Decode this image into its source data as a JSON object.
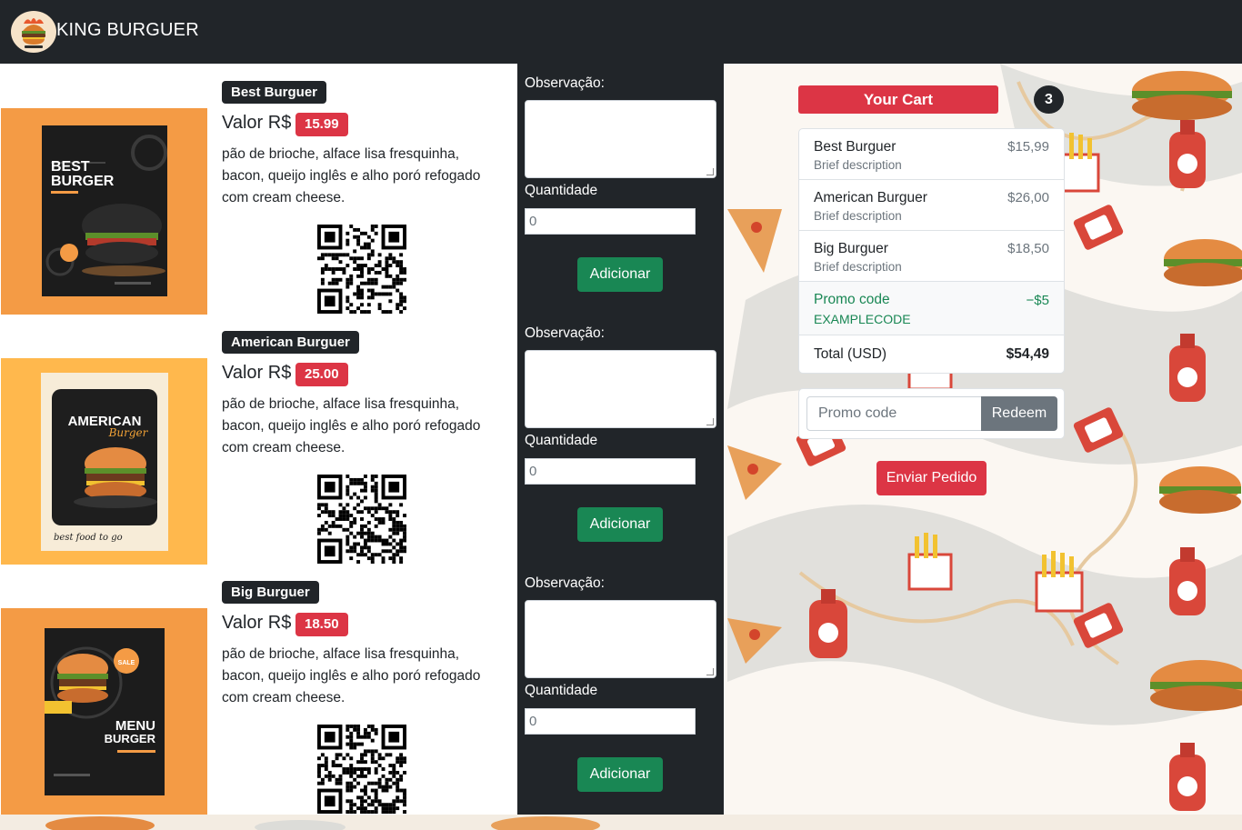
{
  "navbar": {
    "brand": "KING BURGUER",
    "logo_icon": "burger-logo-icon"
  },
  "products": [
    {
      "name": "Best Burguer",
      "valor_label": "Valor R$",
      "price": "15.99",
      "description": "pão de brioche, alface lisa fresquinha, bacon, queijo inglês e alho poró refogado com cream cheese.",
      "poster_text": [
        "BEST",
        "BURGER"
      ]
    },
    {
      "name": "American Burguer",
      "valor_label": "Valor R$",
      "price": "25.00",
      "description": "pão de brioche, alface lisa fresquinha, bacon, queijo inglês e alho poró refogado com cream cheese.",
      "poster_text": [
        "AMERICAN",
        "Burger"
      ]
    },
    {
      "name": "Big Burguer",
      "valor_label": "Valor R$",
      "price": "18.50",
      "description": "pão de brioche, alface lisa fresquinha, bacon, queijo inglês e alho poró refogado com cream cheese.",
      "poster_text": [
        "MENU",
        "BURGER"
      ]
    }
  ],
  "order_form": {
    "observacao_label": "Observação:",
    "quantidade_label": "Quantidade",
    "quantidade_value": "0",
    "add_button": "Adicionar"
  },
  "cart": {
    "title": "Your Cart",
    "count": "3",
    "items": [
      {
        "name": "Best Burguer",
        "description": "Brief description",
        "price": "$15,99"
      },
      {
        "name": "American Burguer",
        "description": "Brief description",
        "price": "$26,00"
      },
      {
        "name": "Big Burguer",
        "description": "Brief description",
        "price": "$18,50"
      }
    ],
    "promo": {
      "label": "Promo code",
      "code": "EXAMPLECODE",
      "value": "−$5"
    },
    "total": {
      "label": "Total (USD)",
      "value": "$54,49"
    },
    "promo_input_placeholder": "Promo code",
    "redeem_button": "Redeem",
    "send_button": "Enviar Pedido"
  },
  "colors": {
    "navbar": "#212529",
    "danger": "#dc3545",
    "success": "#198754",
    "secondary": "#6c757d",
    "poster_orange": "#f49b45"
  }
}
